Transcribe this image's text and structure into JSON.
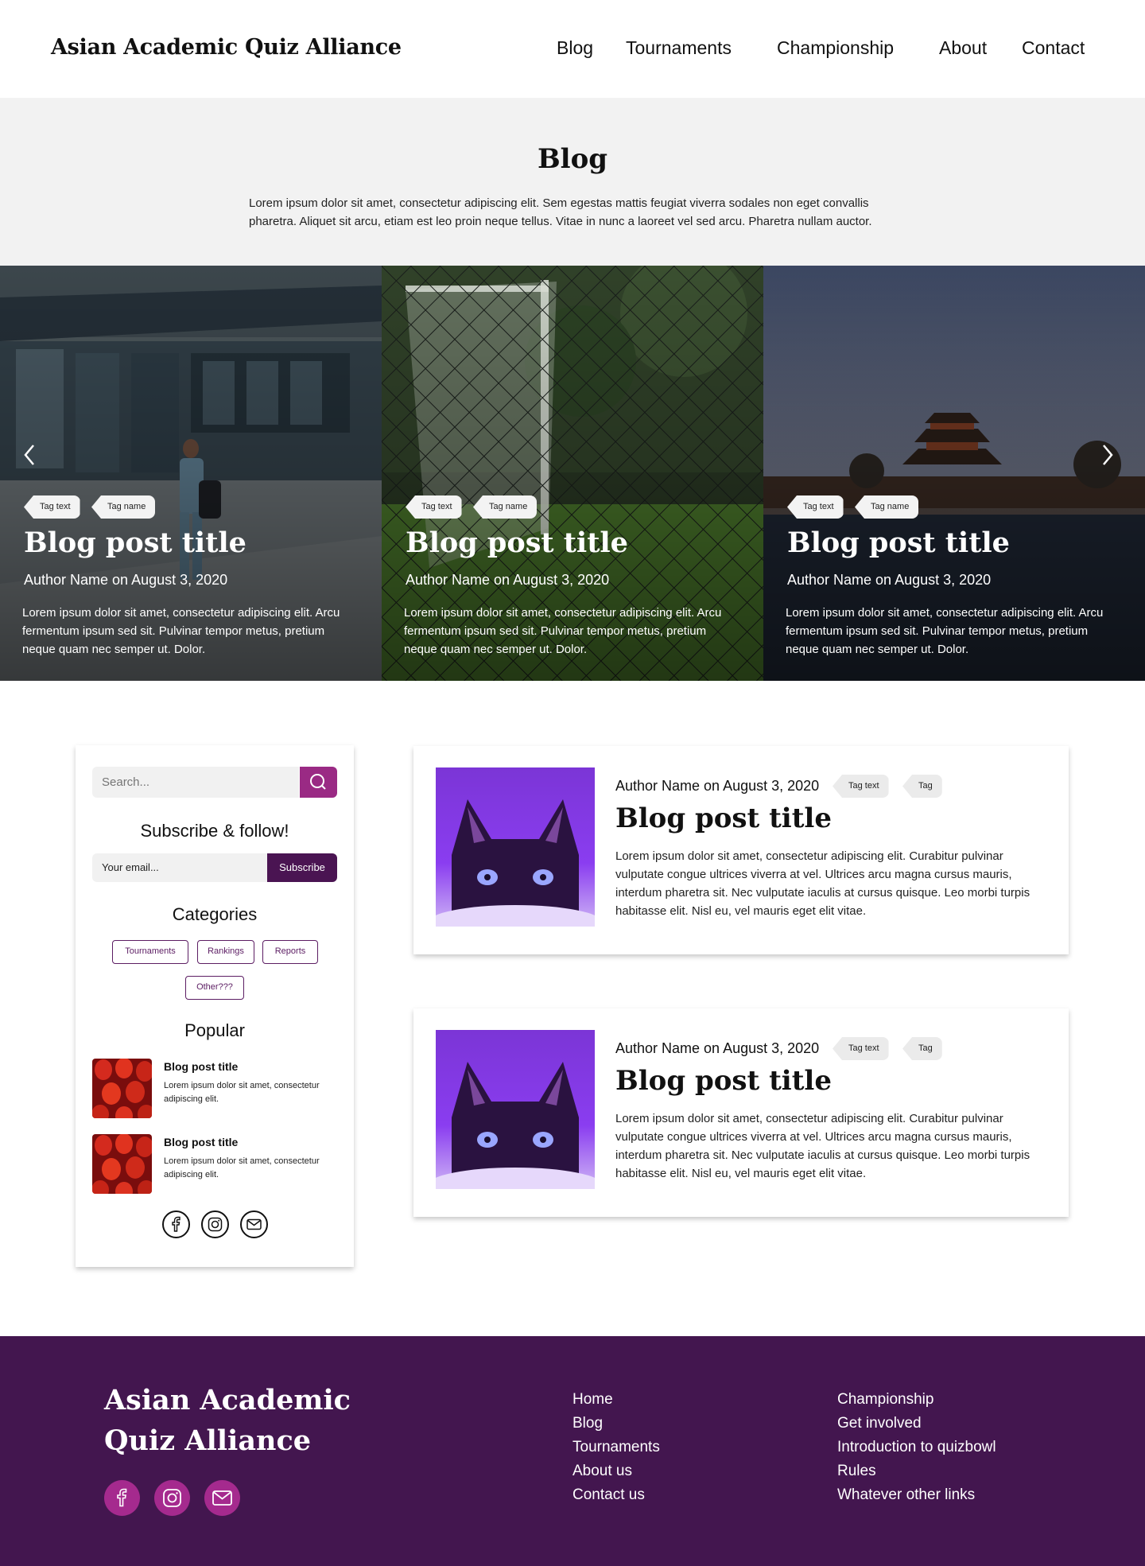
{
  "header": {
    "brand": "Asian Academic Quiz Alliance",
    "nav": [
      "Blog",
      "Tournaments",
      "Championship",
      "About",
      "Contact"
    ]
  },
  "intro": {
    "title": "Blog",
    "text": "Lorem ipsum dolor sit amet, consectetur adipiscing elit. Sem egestas mattis feugiat viverra sodales non eget convallis pharetra. Aliquet sit arcu, etiam est leo proin neque tellus. Vitae in nunc a laoreet vel sed arcu. Pharetra nullam auctor."
  },
  "carousel": {
    "prev_icon": "chevron-left-icon",
    "next_icon": "chevron-right-icon",
    "slides": [
      {
        "tags": [
          "Tag text",
          "Tag name"
        ],
        "title": "Blog post title",
        "author": "Author Name on August 3, 2020",
        "text": "Lorem ipsum dolor sit amet, consectetur adipiscing elit. Arcu fermentum ipsum sed sit. Pulvinar tempor metus, pretium neque quam nec semper ut. Dolor.",
        "image": "businessman-walking-photo"
      },
      {
        "tags": [
          "Tag text",
          "Tag name"
        ],
        "title": "Blog post title",
        "author": "Author Name on August 3, 2020",
        "text": "Lorem ipsum dolor sit amet, consectetur adipiscing elit. Arcu fermentum ipsum sed sit. Pulvinar tempor metus, pretium neque quam nec semper ut. Dolor.",
        "image": "soccer-goal-fence-photo"
      },
      {
        "tags": [
          "Tag text",
          "Tag name"
        ],
        "title": "Blog post title",
        "author": "Author Name on August 3, 2020",
        "text": "Lorem ipsum dolor sit amet, consectetur adipiscing elit. Arcu fermentum ipsum sed sit. Pulvinar tempor metus, pretium neque quam nec semper ut. Dolor.",
        "image": "forbidden-city-tower-photo"
      }
    ]
  },
  "sidebar": {
    "search_placeholder": "Search...",
    "subscribe_title": "Subscribe & follow!",
    "email_placeholder": "Your email...",
    "subscribe_label": "Subscribe",
    "categories_title": "Categories",
    "categories": [
      "Tournaments",
      "Rankings",
      "Reports",
      "Other???"
    ],
    "popular_title": "Popular",
    "popular": [
      {
        "title": "Blog post title",
        "text": "Lorem ipsum dolor sit amet, consectetur adipiscing elit."
      },
      {
        "title": "Blog post title",
        "text": "Lorem ipsum dolor sit amet, consectetur adipiscing elit."
      }
    ],
    "social_icons": [
      "facebook-icon",
      "instagram-icon",
      "mail-icon"
    ]
  },
  "posts": [
    {
      "author": "Author Name on August 3, 2020",
      "tags": [
        "Tag text",
        "Tag"
      ],
      "title": "Blog post title",
      "text": "Lorem ipsum dolor sit amet, consectetur adipiscing elit. Curabitur pulvinar vulputate congue ultrices viverra at vel. Ultrices arcu magna cursus mauris, interdum pharetra sit. Nec vulputate iaculis at cursus quisque. Leo morbi turpis habitasse elit. Nisl eu, vel mauris eget elit vitae.",
      "image": "purple-cat-photo"
    },
    {
      "author": "Author Name on August 3, 2020",
      "tags": [
        "Tag text",
        "Tag"
      ],
      "title": "Blog post title",
      "text": "Lorem ipsum dolor sit amet, consectetur adipiscing elit. Curabitur pulvinar vulputate congue ultrices viverra at vel. Ultrices arcu magna cursus mauris, interdum pharetra sit. Nec vulputate iaculis at cursus quisque. Leo morbi turpis habitasse elit. Nisl eu, vel mauris eget elit vitae.",
      "image": "purple-cat-photo"
    }
  ],
  "footer": {
    "brand": "Asian Academic Quiz Alliance",
    "links_col1": [
      "Home",
      "Blog",
      "Tournaments",
      "About us",
      "Contact us"
    ],
    "links_col2": [
      "Championship",
      "Get involved",
      "Introduction to quizbowl",
      "Rules",
      "Whatever other links"
    ],
    "social_icons": [
      "facebook-icon",
      "instagram-icon",
      "mail-icon"
    ]
  },
  "colors": {
    "accent": "#9a2a84",
    "dark_purple": "#4a1452",
    "footer_bg": "#43164f",
    "footer_social": "#a52a8e",
    "intro_bg": "#f2f2f2"
  }
}
